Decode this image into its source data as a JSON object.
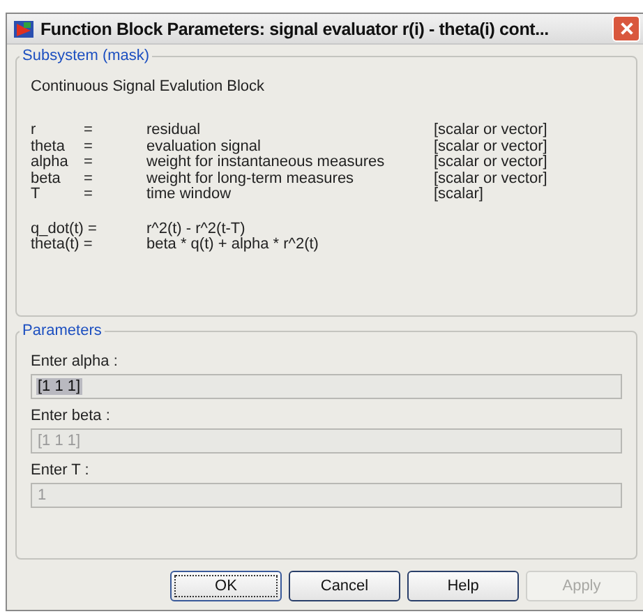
{
  "window": {
    "title": "Function Block Parameters: signal evaluator r(i) - theta(i) cont..."
  },
  "mask": {
    "title": "Subsystem (mask)",
    "description": "Continuous Signal Evalution Block",
    "definitions": [
      {
        "symbol": "r",
        "equals": "=",
        "meaning": "residual",
        "type": "[scalar or vector]"
      },
      {
        "symbol": "theta",
        "equals": "=",
        "meaning": "evaluation signal",
        "type": "[scalar or vector]"
      },
      {
        "symbol": "alpha",
        "equals": "=",
        "meaning": "weight for instantaneous measures",
        "type": "[scalar or vector]"
      },
      {
        "symbol": "beta",
        "equals": "=",
        "meaning": "weight for long-term measures",
        "type": "[scalar or vector]"
      },
      {
        "symbol": "T",
        "equals": "=",
        "meaning": "time window",
        "type": "[scalar]"
      }
    ],
    "equations": [
      {
        "lhs": "q_dot(t) =",
        "rhs": "r^2(t) - r^2(t-T)"
      },
      {
        "lhs": "theta(t) =",
        "rhs": "beta * q(t) + alpha * r^2(t)"
      }
    ]
  },
  "parameters": {
    "title": "Parameters",
    "fields": [
      {
        "label": "Enter alpha :",
        "value": "[1 1 1]",
        "focused": true,
        "disabled": false
      },
      {
        "label": "Enter beta :",
        "value": "[1 1 1]",
        "focused": false,
        "disabled": true
      },
      {
        "label": "Enter T :",
        "value": "1",
        "focused": false,
        "disabled": true
      }
    ]
  },
  "buttons": [
    {
      "label": "OK",
      "default": true,
      "disabled": false
    },
    {
      "label": "Cancel",
      "default": false,
      "disabled": false
    },
    {
      "label": "Help",
      "default": false,
      "disabled": false
    },
    {
      "label": "Apply",
      "default": false,
      "disabled": true
    }
  ]
}
